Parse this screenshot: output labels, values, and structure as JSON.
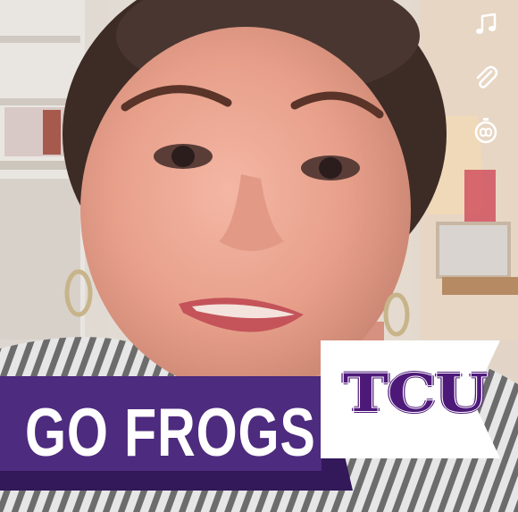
{
  "overlay": {
    "banner_text": "GO FROGS!",
    "logo_text": "TCU"
  },
  "toolbar": {
    "items": [
      {
        "icon": "music-note-icon"
      },
      {
        "icon": "paperclip-icon"
      },
      {
        "icon": "timer-icon"
      }
    ]
  },
  "colors": {
    "tcu_purple": "#4d1979",
    "banner_purple": "#4d2b7e",
    "banner_shadow": "#33185a",
    "icon_white": "#ffffff"
  }
}
